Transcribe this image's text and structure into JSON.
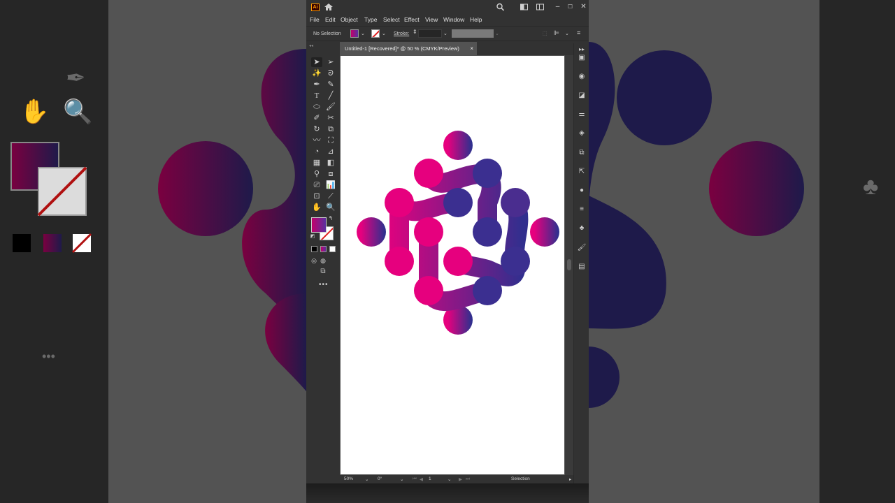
{
  "app": {
    "logo_text": "Ai",
    "menu": [
      "File",
      "Edit",
      "Object",
      "Type",
      "Select",
      "Effect",
      "View",
      "Window",
      "Help"
    ]
  },
  "control_bar": {
    "selection_label": "No Selection",
    "stroke_label": "Stroke:"
  },
  "document_tab": {
    "title": "Untitled-1 [Recovered]* @ 50 % (CMYK/Preview)",
    "close_glyph": "×"
  },
  "status_bar": {
    "zoom": "50%",
    "rotation": "0°",
    "artboard_number": "1",
    "tool_name": "Selection"
  },
  "colors": {
    "gradient_start": "#e6007e",
    "gradient_end": "#312f8e",
    "canvas_bg": "#535353",
    "ui_bg": "#323232"
  },
  "icons": {
    "titlebar": [
      "search-icon",
      "arrange-documents-icon",
      "workspace-icon",
      "minimize-icon",
      "maximize-icon",
      "close-icon"
    ],
    "right_panel": [
      "properties-icon",
      "appearance-icon",
      "gradient-icon",
      "adjustments-icon",
      "layers-icon",
      "pathfinder-icon",
      "asset-export-icon",
      "color-icon",
      "align-icon",
      "symbols-icon",
      "brushes-icon",
      "libraries-icon"
    ]
  }
}
